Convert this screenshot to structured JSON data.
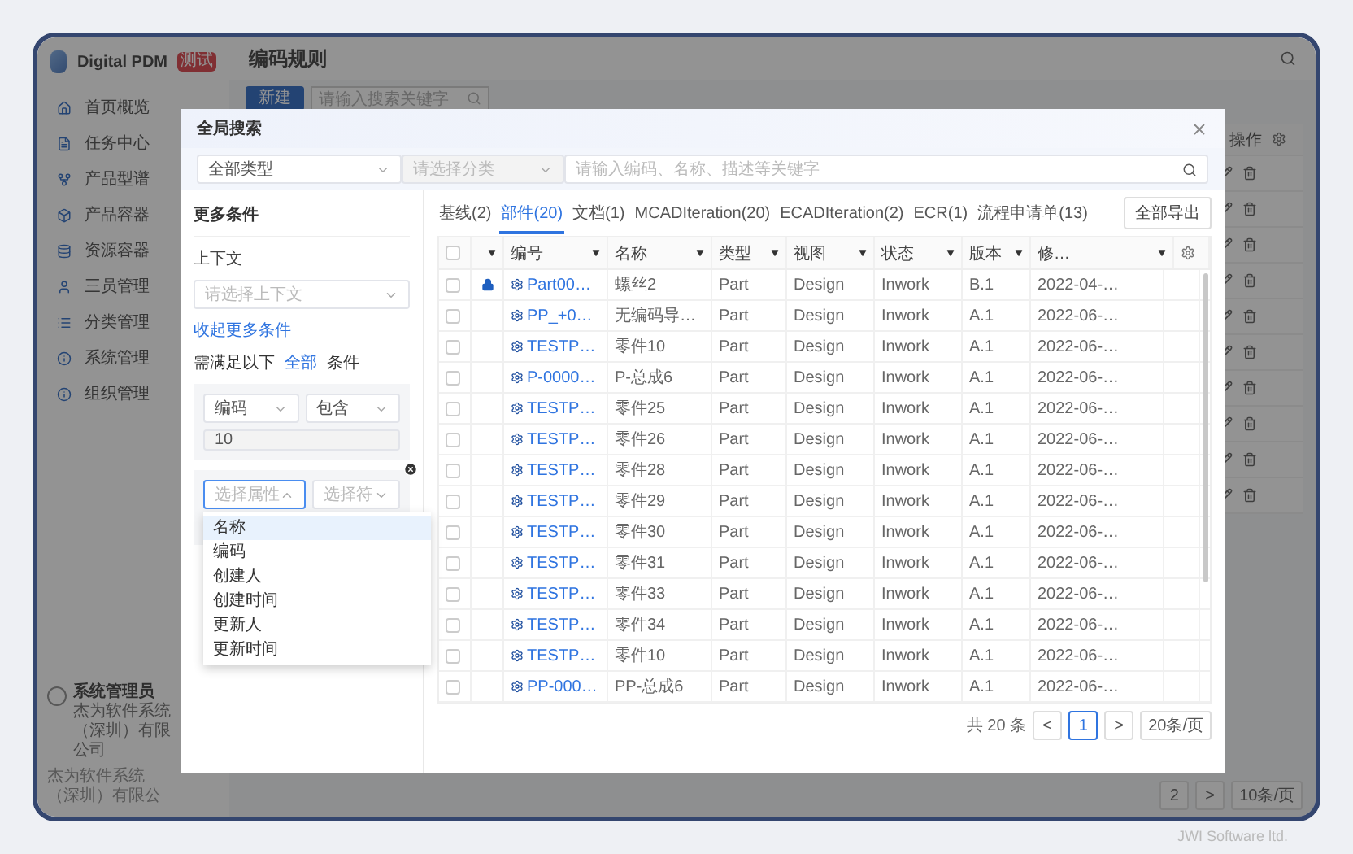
{
  "app": {
    "logo_text": "Digital PDM",
    "badge": "测试",
    "nav": [
      {
        "label": "首页概览"
      },
      {
        "label": "任务中心"
      },
      {
        "label": "产品型谱"
      },
      {
        "label": "产品容器"
      },
      {
        "label": "资源容器"
      },
      {
        "label": "三员管理"
      },
      {
        "label": "分类管理"
      },
      {
        "label": "系统管理"
      },
      {
        "label": "组织管理"
      }
    ],
    "user": {
      "name": "系统管理员",
      "company": "杰为软件系统（深圳）有限公司"
    },
    "footer": "杰为软件系统（深圳）有限公"
  },
  "page": {
    "title": "编码规则",
    "new_button": "新建",
    "search": {
      "placeholder": "请输入搜索关键字"
    },
    "table": {
      "action_header": "操作",
      "rows": [
        {
          "kind": "edit-delete"
        },
        {
          "kind": "edit-delete"
        },
        {
          "kind": "edit-delete"
        },
        {
          "kind": "edit-delete"
        },
        {
          "kind": "edit-delete"
        },
        {
          "kind": "edit-delete"
        },
        {
          "kind": "edit-delete"
        },
        {
          "kind": "edit-delete"
        },
        {
          "kind": "edit-delete"
        },
        {
          "kind": "edit-delete"
        }
      ]
    },
    "pagination": {
      "page": "2",
      "next": ">",
      "page_size": "10条/页"
    }
  },
  "modal": {
    "title": "全局搜索",
    "type_select": "全部类型",
    "category_select": {
      "placeholder": "请选择分类",
      "disabled": true
    },
    "search": {
      "placeholder": "请输入编码、名称、描述等关键字"
    },
    "conditions": {
      "title": "更多条件",
      "context_label": "上下文",
      "context_select": {
        "placeholder": "请选择上下文"
      },
      "collapse_link": "收起更多条件",
      "match": {
        "prefix": "需满足以下",
        "mode": "全部",
        "suffix": "条件"
      },
      "groups": [
        {
          "attribute": {
            "value": "编码"
          },
          "operator": {
            "value": "包含"
          },
          "value": "10",
          "removable": false,
          "open": false
        },
        {
          "attribute": {
            "placeholder": "选择属性"
          },
          "operator": {
            "placeholder": "选择符"
          },
          "removable": true,
          "open": true
        }
      ],
      "dropdown": [
        {
          "label": "名称",
          "selected": true
        },
        {
          "label": "编码",
          "selected": false
        },
        {
          "label": "创建人",
          "selected": false
        },
        {
          "label": "创建时间",
          "selected": false
        },
        {
          "label": "更新人",
          "selected": false
        },
        {
          "label": "更新时间",
          "selected": false
        }
      ]
    },
    "tabs": [
      {
        "label": "基线(2)",
        "selected": false
      },
      {
        "label": "部件(20)",
        "selected": true
      },
      {
        "label": "文档(1)",
        "selected": false
      },
      {
        "label": "MCADIteration(20)",
        "selected": false
      },
      {
        "label": "ECADIteration(2)",
        "selected": false
      },
      {
        "label": "ECR(1)",
        "selected": false
      },
      {
        "label": "流程申请单(13)",
        "selected": false
      }
    ],
    "export_button": "全部导出",
    "table": {
      "select_all": {
        "checked": false
      },
      "columns": [
        "编号",
        "名称",
        "类型",
        "视图",
        "状态",
        "版本",
        "修…"
      ],
      "rows": [
        {
          "checked": false,
          "locked": true,
          "code": "Part00…",
          "name": "螺丝2",
          "type": "Part",
          "view": "Design",
          "state": "Inwork",
          "version": "B.1",
          "modified": "2022-04-…"
        },
        {
          "checked": false,
          "locked": false,
          "code": "PP_+0…",
          "name": "无编码导…",
          "type": "Part",
          "view": "Design",
          "state": "Inwork",
          "version": "A.1",
          "modified": "2022-06-…"
        },
        {
          "checked": false,
          "locked": false,
          "code": "TESTP…",
          "name": "零件10",
          "type": "Part",
          "view": "Design",
          "state": "Inwork",
          "version": "A.1",
          "modified": "2022-06-…"
        },
        {
          "checked": false,
          "locked": false,
          "code": "P-0000…",
          "name": "P-总成6",
          "type": "Part",
          "view": "Design",
          "state": "Inwork",
          "version": "A.1",
          "modified": "2022-06-…"
        },
        {
          "checked": false,
          "locked": false,
          "code": "TESTP…",
          "name": "零件25",
          "type": "Part",
          "view": "Design",
          "state": "Inwork",
          "version": "A.1",
          "modified": "2022-06-…"
        },
        {
          "checked": false,
          "locked": false,
          "code": "TESTP…",
          "name": "零件26",
          "type": "Part",
          "view": "Design",
          "state": "Inwork",
          "version": "A.1",
          "modified": "2022-06-…"
        },
        {
          "checked": false,
          "locked": false,
          "code": "TESTP…",
          "name": "零件28",
          "type": "Part",
          "view": "Design",
          "state": "Inwork",
          "version": "A.1",
          "modified": "2022-06-…"
        },
        {
          "checked": false,
          "locked": false,
          "code": "TESTP…",
          "name": "零件29",
          "type": "Part",
          "view": "Design",
          "state": "Inwork",
          "version": "A.1",
          "modified": "2022-06-…"
        },
        {
          "checked": false,
          "locked": false,
          "code": "TESTP…",
          "name": "零件30",
          "type": "Part",
          "view": "Design",
          "state": "Inwork",
          "version": "A.1",
          "modified": "2022-06-…"
        },
        {
          "checked": false,
          "locked": false,
          "code": "TESTP…",
          "name": "零件31",
          "type": "Part",
          "view": "Design",
          "state": "Inwork",
          "version": "A.1",
          "modified": "2022-06-…"
        },
        {
          "checked": false,
          "locked": false,
          "code": "TESTP…",
          "name": "零件33",
          "type": "Part",
          "view": "Design",
          "state": "Inwork",
          "version": "A.1",
          "modified": "2022-06-…"
        },
        {
          "checked": false,
          "locked": false,
          "code": "TESTP…",
          "name": "零件34",
          "type": "Part",
          "view": "Design",
          "state": "Inwork",
          "version": "A.1",
          "modified": "2022-06-…"
        },
        {
          "checked": false,
          "locked": false,
          "code": "TESTP…",
          "name": "零件10",
          "type": "Part",
          "view": "Design",
          "state": "Inwork",
          "version": "A.1",
          "modified": "2022-06-…"
        },
        {
          "checked": false,
          "locked": false,
          "code": "PP-000…",
          "name": "PP-总成6",
          "type": "Part",
          "view": "Design",
          "state": "Inwork",
          "version": "A.1",
          "modified": "2022-06-…"
        }
      ]
    },
    "pagination": {
      "total": "共 20 条",
      "prev": "<",
      "pages": [
        {
          "label": "1",
          "selected": true
        }
      ],
      "next": ">",
      "page_size": "20条/页"
    }
  },
  "credit": "JWI Software ltd."
}
